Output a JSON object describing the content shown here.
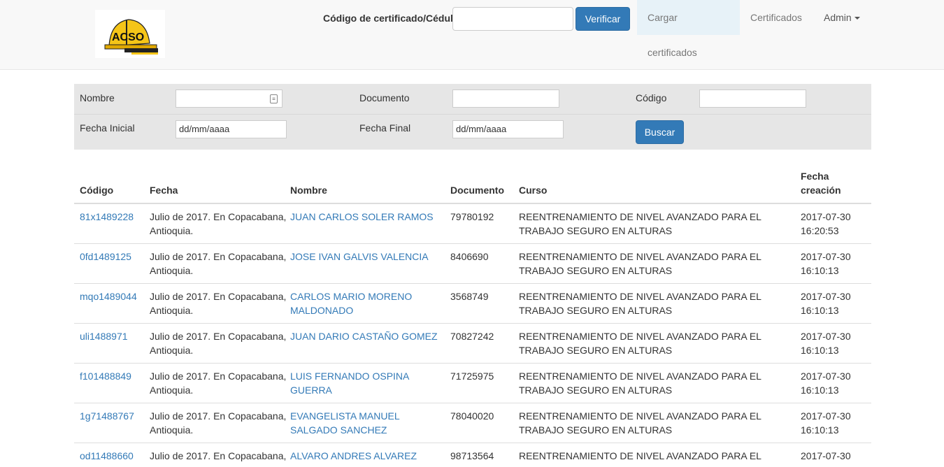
{
  "header": {
    "verify_label": "Código de certificado/Cédula",
    "verify_value": "",
    "verify_button": "Verificar",
    "nav": {
      "upload": "Cargar certificados",
      "certificates": "Certificados",
      "admin": "Admin"
    }
  },
  "filters": {
    "name_label": "Nombre",
    "document_label": "Documento",
    "code_label": "Código",
    "start_label": "Fecha Inicial",
    "start_value": "dd/mm/aaaa",
    "end_label": "Fecha Final",
    "end_value": "dd/mm/aaaa",
    "search_button": "Buscar"
  },
  "table": {
    "headers": {
      "code": "Código",
      "date": "Fecha",
      "name": "Nombre",
      "document": "Documento",
      "course": "Curso",
      "created_1": "Fecha",
      "created_2": "creación"
    },
    "rows": [
      {
        "code": "81x1489228",
        "date1": "Julio de 2017. En Copacabana,",
        "date2": "Antioquia.",
        "name1": "JUAN CARLOS SOLER RAMOS",
        "name2": "",
        "document": "79780192",
        "course1": "REENTRENAMIENTO DE NIVEL AVANZADO PARA EL",
        "course2": "TRABAJO SEGURO EN ALTURAS",
        "created1": "2017-07-30",
        "created2": "16:20:53"
      },
      {
        "code": "0fd1489125",
        "date1": "Julio de 2017. En Copacabana,",
        "date2": "Antioquia.",
        "name1": "JOSE IVAN GALVIS VALENCIA",
        "name2": "",
        "document": "8406690",
        "course1": "REENTRENAMIENTO DE NIVEL AVANZADO PARA EL",
        "course2": "TRABAJO SEGURO EN ALTURAS",
        "created1": "2017-07-30",
        "created2": "16:10:13"
      },
      {
        "code": "mqo1489044",
        "date1": "Julio de 2017. En Copacabana,",
        "date2": "Antioquia.",
        "name1": "CARLOS MARIO MORENO",
        "name2": "MALDONADO",
        "document": "3568749",
        "course1": "REENTRENAMIENTO DE NIVEL AVANZADO PARA EL",
        "course2": "TRABAJO SEGURO EN ALTURAS",
        "created1": "2017-07-30",
        "created2": "16:10:13"
      },
      {
        "code": "uli1488971",
        "date1": "Julio de 2017. En Copacabana,",
        "date2": "Antioquia.",
        "name1": "JUAN DARIO CASTAÑO GOMEZ",
        "name2": "",
        "document": "70827242",
        "course1": "REENTRENAMIENTO DE NIVEL AVANZADO PARA EL",
        "course2": "TRABAJO SEGURO EN ALTURAS",
        "created1": "2017-07-30",
        "created2": "16:10:13"
      },
      {
        "code": "f101488849",
        "date1": "Julio de 2017. En Copacabana,",
        "date2": "Antioquia.",
        "name1": "LUIS FERNANDO OSPINA",
        "name2": "GUERRA",
        "document": "71725975",
        "course1": "REENTRENAMIENTO DE NIVEL AVANZADO PARA EL",
        "course2": "TRABAJO SEGURO EN ALTURAS",
        "created1": "2017-07-30",
        "created2": "16:10:13"
      },
      {
        "code": "1g71488767",
        "date1": "Julio de 2017. En Copacabana,",
        "date2": "Antioquia.",
        "name1": "EVANGELISTA MANUEL",
        "name2": "SALGADO SANCHEZ",
        "document": "78040020",
        "course1": "REENTRENAMIENTO DE NIVEL AVANZADO PARA EL",
        "course2": "TRABAJO SEGURO EN ALTURAS",
        "created1": "2017-07-30",
        "created2": "16:10:13"
      },
      {
        "code": "od11488660",
        "date1": "Julio de 2017. En Copacabana,",
        "date2": "",
        "name1": "ALVARO ANDRES ALVAREZ",
        "name2": "",
        "document": "98713564",
        "course1": "REENTRENAMIENTO DE NIVEL AVANZADO PARA EL",
        "course2": "",
        "created1": "2017-07-30",
        "created2": ""
      }
    ]
  }
}
